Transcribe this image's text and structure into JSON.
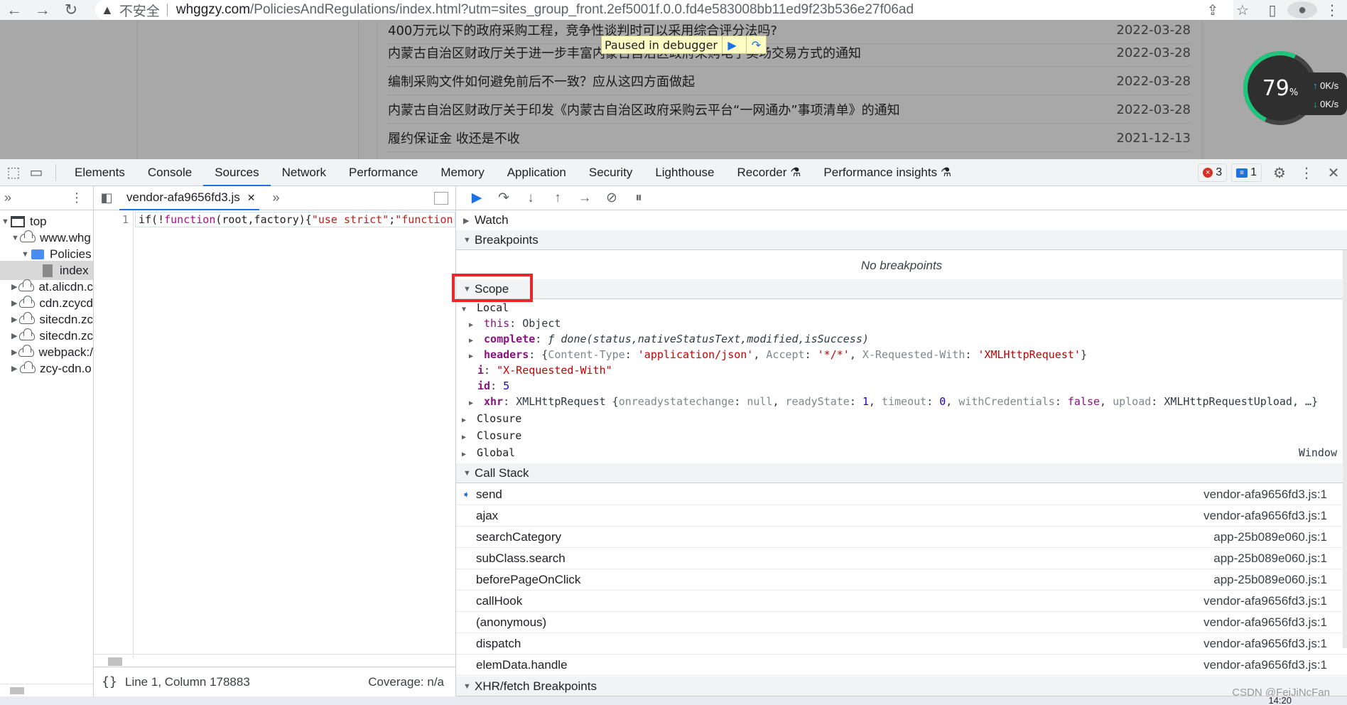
{
  "browser": {
    "insecure_label": "不安全",
    "url_host": "whggzy.com",
    "url_path": "/PoliciesAndRegulations/index.html?utm=sites_group_front.2ef5001f.0.0.fd4e583008bb11ed9f23b536e27f06ad"
  },
  "page": {
    "news": [
      {
        "title": "400万元以下的政府采购工程，竞争性谈判时可以采用综合评分法吗?",
        "date": "2022-03-28"
      },
      {
        "title": "内蒙古自治区财政厅关于进一步丰富内蒙古自治区政府采购电子卖场交易方式的通知",
        "date": "2022-03-28"
      },
      {
        "title": "编制采购文件如何避免前后不一致？应从这四方面做起",
        "date": "2022-03-28"
      },
      {
        "title": "内蒙古自治区财政厅关于印发《内蒙古自治区政府采购云平台“一网通办”事项清单》的通知",
        "date": "2022-03-28"
      },
      {
        "title": "履约保证金 收还是不收",
        "date": "2021-12-13"
      }
    ],
    "paused_label": "Paused in debugger",
    "speed": {
      "percent": "79",
      "percent_unit": "%",
      "up": "0K/s",
      "down": "0K/s"
    }
  },
  "devtools": {
    "tabs": [
      "Elements",
      "Console",
      "Sources",
      "Network",
      "Performance",
      "Memory",
      "Application",
      "Security",
      "Lighthouse",
      "Recorder",
      "Performance insights"
    ],
    "active_tab": "Sources",
    "error_count": "3",
    "message_count": "1"
  },
  "navigator": {
    "items": [
      {
        "label": "top",
        "depth": 0,
        "expanded": true,
        "icon": "frame-icon"
      },
      {
        "label": "www.whg",
        "depth": 1,
        "expanded": true,
        "icon": "cloud-icon"
      },
      {
        "label": "Policies",
        "depth": 2,
        "expanded": true,
        "icon": "folder-icon"
      },
      {
        "label": "index",
        "depth": 3,
        "icon": "file-icon",
        "selected": true
      },
      {
        "label": "at.alicdn.c",
        "depth": 1,
        "expanded": false,
        "icon": "cloud-icon"
      },
      {
        "label": "cdn.zcycd",
        "depth": 1,
        "expanded": false,
        "icon": "cloud-icon"
      },
      {
        "label": "sitecdn.zc",
        "depth": 1,
        "expanded": false,
        "icon": "cloud-icon"
      },
      {
        "label": "sitecdn.zc",
        "depth": 1,
        "expanded": false,
        "icon": "cloud-icon"
      },
      {
        "label": "webpack:/",
        "depth": 1,
        "expanded": false,
        "icon": "cloud-icon"
      },
      {
        "label": "zcy-cdn.o",
        "depth": 1,
        "expanded": false,
        "icon": "cloud-icon"
      }
    ]
  },
  "editor": {
    "file_tab": "vendor-afa9656fd3.js",
    "line_number": "1",
    "code": {
      "p1": "if(!",
      "k1": "function",
      "p2": "(root,factory){",
      "s1": "\"use strict\"",
      "p3": ";",
      "s2": "\"function\""
    },
    "status_position": "Line 1, Column 178883",
    "coverage": "Coverage: n/a"
  },
  "debugger": {
    "watch": "Watch",
    "breakpoints": "Breakpoints",
    "no_breakpoints": "No breakpoints",
    "scope": "Scope",
    "local": "Local",
    "scope_lines": {
      "this_k": "this",
      "this_v": "Object",
      "complete_k": "complete",
      "complete_f": "ƒ",
      "complete_v": "done(status,nativeStatusText,modified,isSuccess)",
      "headers_k": "headers",
      "headers_ct_k": "Content-Type",
      "headers_ct_v": "'application/json'",
      "headers_ac_k": "Accept",
      "headers_ac_v": "'*/*'",
      "headers_xr_k": "X-Requested-With",
      "headers_xr_v": "'XMLHttpRequest'",
      "i_k": "i",
      "i_v": "\"X-Requested-With\"",
      "id_k": "id",
      "id_v": "5",
      "xhr_k": "xhr",
      "xhr_cls": "XMLHttpRequest",
      "xhr_a_k": "onreadystatechange",
      "xhr_a_v": "null",
      "xhr_b_k": "readyState",
      "xhr_b_v": "1",
      "xhr_c_k": "timeout",
      "xhr_c_v": "0",
      "xhr_d_k": "withCredentials",
      "xhr_d_v": "false",
      "xhr_e_k": "upload",
      "xhr_e_v": "XMLHttpRequestUpload",
      "closure1": "Closure",
      "closure2": "Closure",
      "global": "Global",
      "global_v": "Window"
    },
    "call_stack": "Call Stack",
    "frames": [
      {
        "name": "send",
        "loc": "vendor-afa9656fd3.js:1",
        "current": true
      },
      {
        "name": "ajax",
        "loc": "vendor-afa9656fd3.js:1"
      },
      {
        "name": "searchCategory",
        "loc": "app-25b089e060.js:1"
      },
      {
        "name": "subClass.search",
        "loc": "app-25b089e060.js:1"
      },
      {
        "name": "beforePageOnClick",
        "loc": "app-25b089e060.js:1"
      },
      {
        "name": "callHook",
        "loc": "vendor-afa9656fd3.js:1"
      },
      {
        "name": "(anonymous)",
        "loc": "vendor-afa9656fd3.js:1"
      },
      {
        "name": "dispatch",
        "loc": "vendor-afa9656fd3.js:1"
      },
      {
        "name": "elemData.handle",
        "loc": "vendor-afa9656fd3.js:1"
      }
    ],
    "xhr_bp": "XHR/fetch Breakpoints"
  },
  "watermark": "CSDN @FeiJiNcFan",
  "taskbar_time": "14:20"
}
